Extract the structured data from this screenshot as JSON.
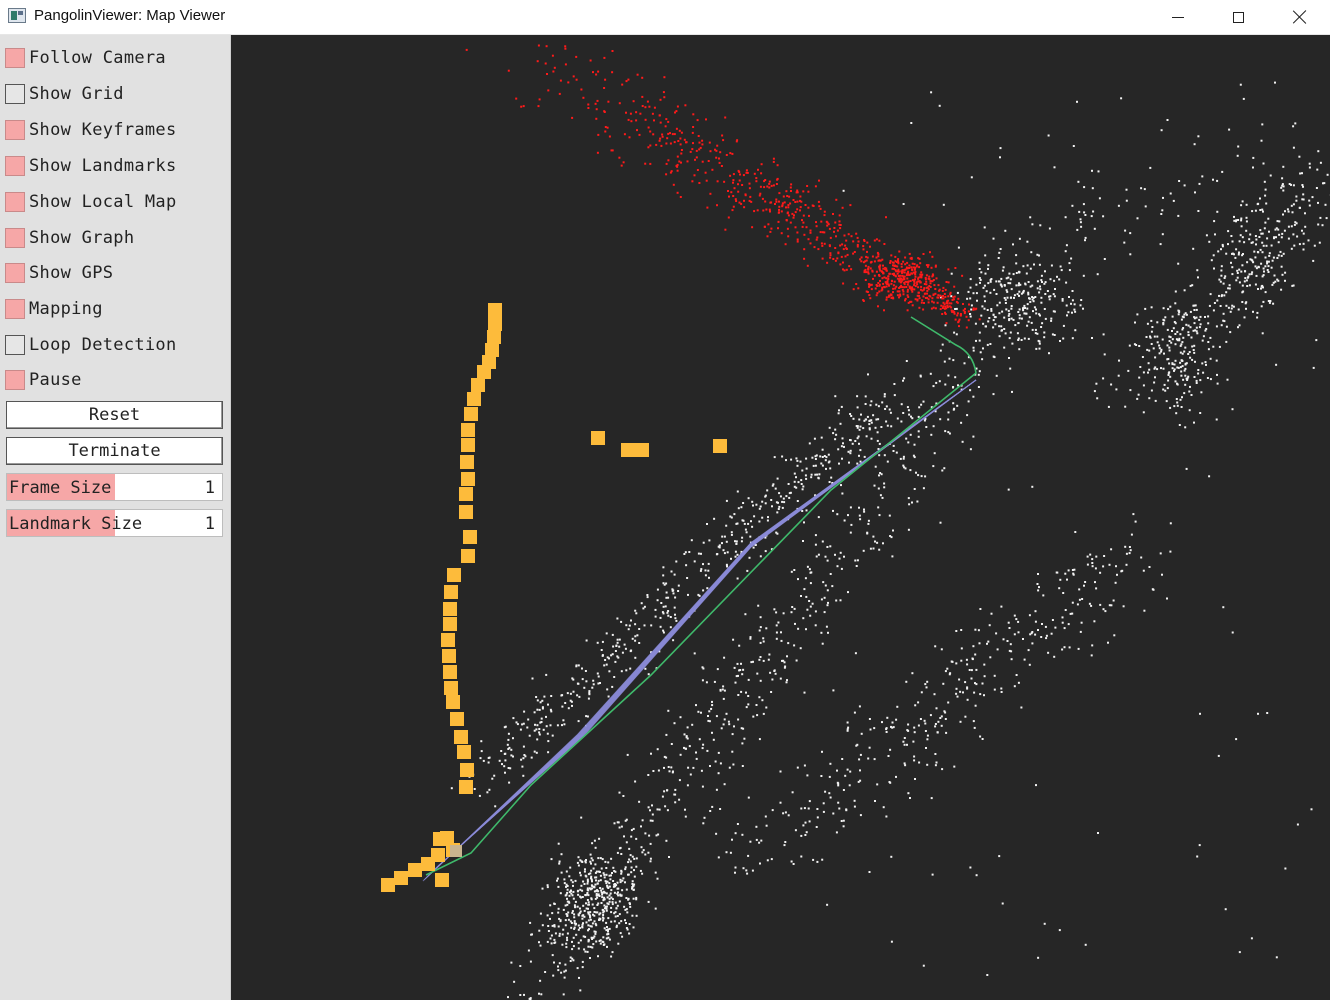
{
  "window": {
    "title": "PangolinViewer: Map Viewer"
  },
  "panel": {
    "checkboxes": [
      {
        "label": "Follow Camera",
        "checked": true
      },
      {
        "label": "Show Grid",
        "checked": false
      },
      {
        "label": "Show Keyframes",
        "checked": true
      },
      {
        "label": "Show Landmarks",
        "checked": true
      },
      {
        "label": "Show Local Map",
        "checked": true
      },
      {
        "label": "Show Graph",
        "checked": true
      },
      {
        "label": "Show GPS",
        "checked": true
      },
      {
        "label": "Mapping",
        "checked": true
      },
      {
        "label": "Loop Detection",
        "checked": false
      },
      {
        "label": "Pause",
        "checked": true
      }
    ],
    "buttons": {
      "reset": "Reset",
      "terminate": "Terminate"
    },
    "sliders": {
      "frame_size": {
        "label": "Frame Size",
        "value": "1",
        "fraction": 0.5
      },
      "landmark_size": {
        "label": "Landmark Size",
        "value": "1",
        "fraction": 0.5
      }
    }
  },
  "colors": {
    "checked": "#f6a7a7",
    "viewer_bg": "#262626",
    "landmarks": "#f2f2f2",
    "local_map": "#ff1a1a",
    "keyframes": "#fdbb3b",
    "graph": "#8c8cd9",
    "trajectory": "#3fb96b"
  }
}
